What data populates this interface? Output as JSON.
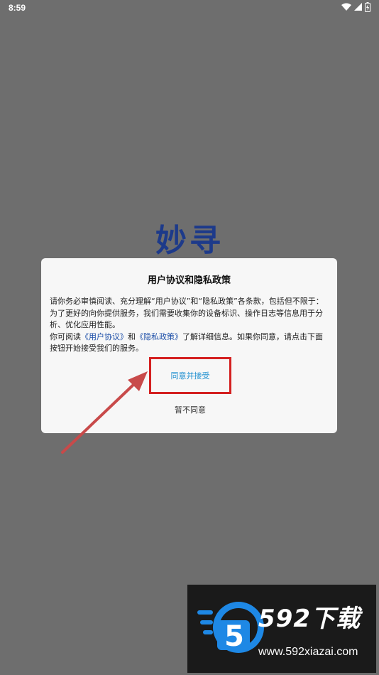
{
  "status_bar": {
    "time": "8:59"
  },
  "app": {
    "logo_text": "妙寻"
  },
  "dialog": {
    "title": "用户协议和隐私政策",
    "paragraph1": "请你务必审慎阅读、充分理解“用户协议”和“隐私政策”各条款，包括但不限于：为了更好的向你提供服务，我们需要收集你的设备标识、操作日志等信息用于分析、优化应用性能。",
    "p2_prefix": "你可阅读",
    "link_user_agreement": "《用户协议》",
    "p2_and": "和",
    "link_privacy_policy": "《隐私政策》",
    "p2_suffix": "了解详细信息。如果你同意，请点击下面按钮开始接受我们的服务。",
    "agree_label": "同意并接受",
    "decline_label": "暂不同意"
  },
  "watermark": {
    "logo_digit": "5",
    "title": "592下载",
    "url": "www.592xiazai.com"
  },
  "colors": {
    "overlay": "#6e6e6e",
    "link": "#1d4fa8",
    "agree": "#1d8fd0",
    "highlight": "#d42020"
  }
}
